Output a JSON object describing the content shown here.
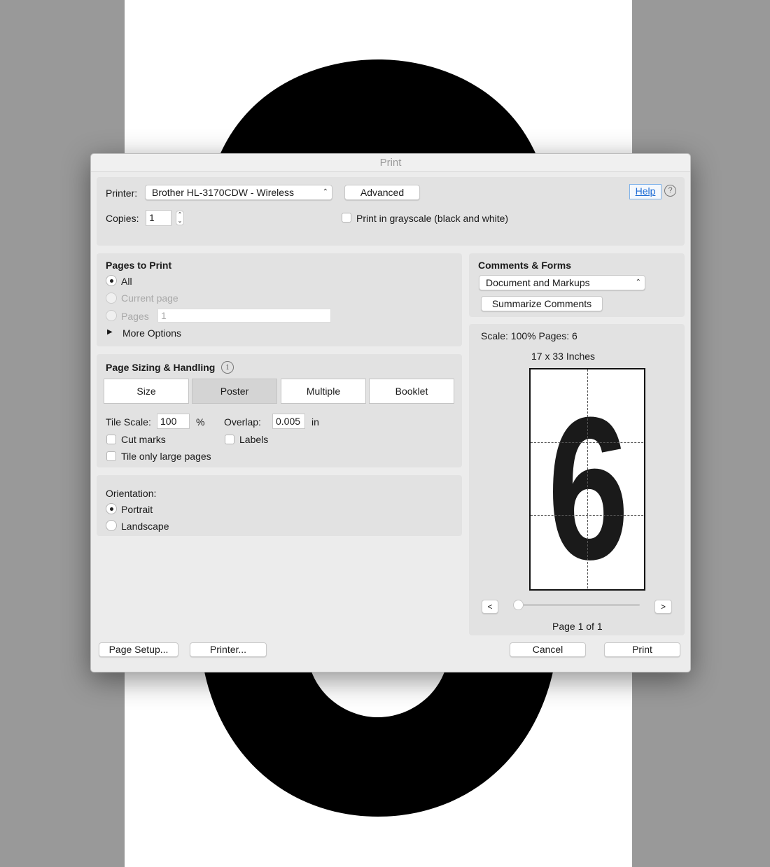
{
  "dialog": {
    "title": "Print"
  },
  "printer": {
    "label": "Printer:",
    "value": "Brother HL-3170CDW - Wireless",
    "advanced": "Advanced",
    "help": "Help",
    "copies_label": "Copies:",
    "copies": "1",
    "grayscale": "Print in grayscale (black and white)"
  },
  "pages": {
    "title": "Pages to Print",
    "all": "All",
    "current": "Current page",
    "pages": "Pages",
    "pages_value": "1",
    "more": "More Options"
  },
  "sizing": {
    "title": "Page Sizing & Handling",
    "tabs": [
      "Size",
      "Poster",
      "Multiple",
      "Booklet"
    ],
    "active_tab": "Poster",
    "tile_label": "Tile Scale:",
    "tile_value": "100",
    "pct": "%",
    "overlap_label": "Overlap:",
    "overlap_value": "0.005",
    "overlap_unit": "in",
    "cut_marks": "Cut marks",
    "labels": "Labels",
    "tile_large": "Tile only large pages"
  },
  "orientation": {
    "title": "Orientation:",
    "portrait": "Portrait",
    "landscape": "Landscape"
  },
  "comments": {
    "title": "Comments & Forms",
    "value": "Document and Markups",
    "summarize": "Summarize Comments"
  },
  "preview": {
    "scale": "Scale: 100% Pages: 6",
    "size": "17 x 33 Inches",
    "glyph": "6",
    "prev": "<",
    "next": ">",
    "page": "Page 1 of 1",
    "slider_fraction": 0
  },
  "footer": {
    "page_setup": "Page Setup...",
    "printer": "Printer...",
    "cancel": "Cancel",
    "print": "Print"
  }
}
